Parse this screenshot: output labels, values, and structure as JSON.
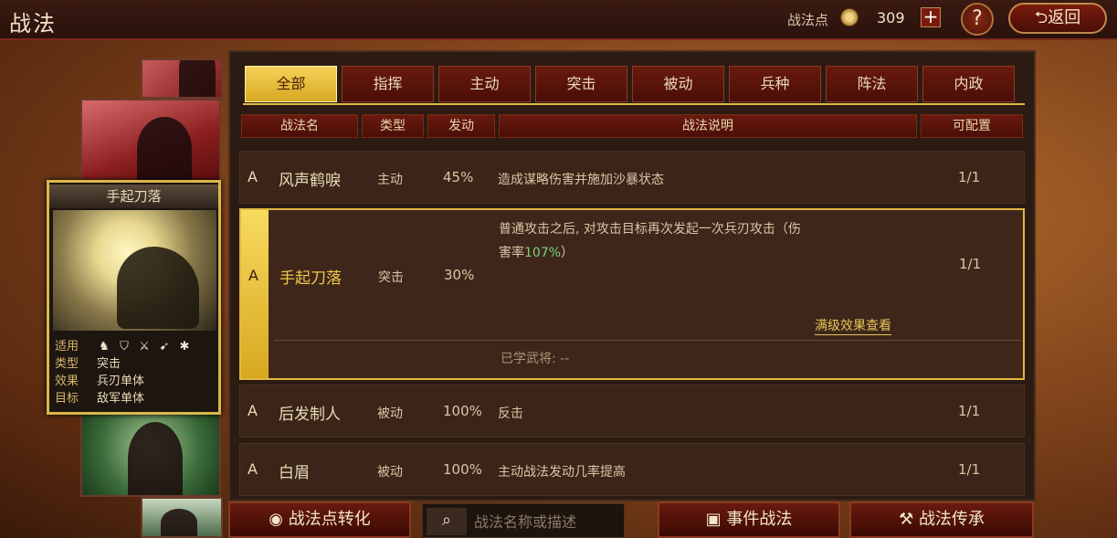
{
  "header": {
    "title": "战法",
    "points_label": "战法点",
    "points_value": "309",
    "plus_label": "+",
    "help_label": "?",
    "back_label": "⮌返回"
  },
  "skill_card": {
    "title": "手起刀落",
    "applies_key": "适用",
    "unit_icons": [
      "cavalry-icon",
      "shield-icon",
      "crossed-swords-icon",
      "spear-icon",
      "wheel-icon"
    ],
    "type_key": "类型",
    "type_val": "突击",
    "effect_key": "效果",
    "effect_val": "兵刃单体",
    "target_key": "目标",
    "target_val": "敌军单体"
  },
  "tabs": [
    "全部",
    "指挥",
    "主动",
    "突击",
    "被动",
    "兵种",
    "阵法",
    "内政"
  ],
  "active_tab": "全部",
  "columns": {
    "name": "战法名",
    "type": "类型",
    "rate": "发动",
    "desc": "战法说明",
    "config": "可配置"
  },
  "rows": [
    {
      "rank": "A",
      "name": "风声鹤唳",
      "type": "主动",
      "rate": "45%",
      "desc": "造成谋略伤害并施加沙暴状态",
      "config": "1/1"
    },
    {
      "rank": "A",
      "name": "手起刀落",
      "type": "突击",
      "rate": "30%",
      "desc_line1": "普通攻击之后, 对攻击目标再次发起一次兵刃攻击（伤",
      "desc_line2_prefix": "害率",
      "desc_highlight": "107%",
      "desc_line2_suffix": "）",
      "config": "1/1",
      "detail_link": "满级效果查看",
      "learned": "已学武将: --"
    },
    {
      "rank": "A",
      "name": "后发制人",
      "type": "被动",
      "rate": "100%",
      "desc": "反击",
      "config": "1/1"
    },
    {
      "rank": "A",
      "name": "白眉",
      "type": "被动",
      "rate": "100%",
      "desc": "主动战法发动几率提高",
      "config": "1/1"
    }
  ],
  "bottom": {
    "convert_label": "战法点转化",
    "search_placeholder": "战法名称或描述",
    "event_label": "事件战法",
    "inherit_label": "战法传承"
  },
  "colors": {
    "accent_gold": "#e0b840",
    "tab_red": "#6a1a0e",
    "highlight_green": "#7ad07a"
  }
}
